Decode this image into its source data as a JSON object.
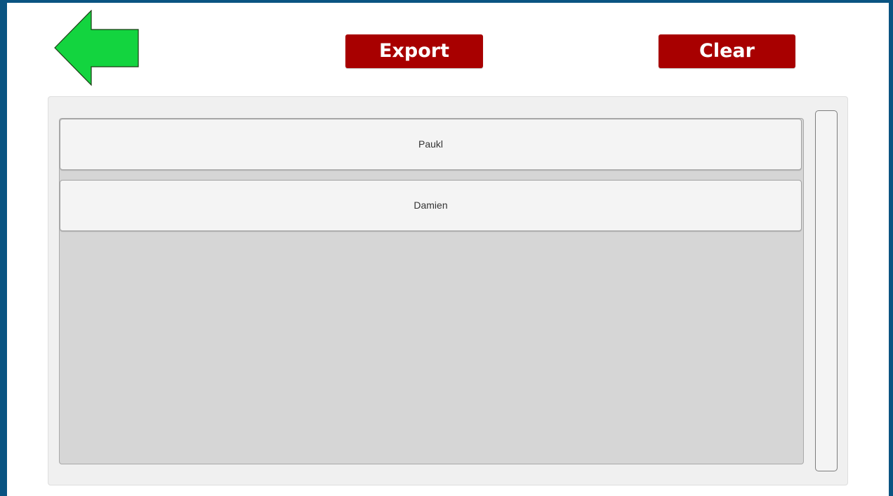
{
  "toolbar": {
    "back_icon": "arrow-left-icon",
    "export_label": "Export",
    "clear_label": "Clear"
  },
  "list": {
    "items": [
      {
        "label": "Paukl"
      },
      {
        "label": "Damien"
      }
    ]
  },
  "colors": {
    "background": "#0a5482",
    "accent_button": "#a80000",
    "back_arrow": "#13d43f",
    "list_background": "#d6d6d6",
    "panel_background": "#f0f0f0"
  }
}
